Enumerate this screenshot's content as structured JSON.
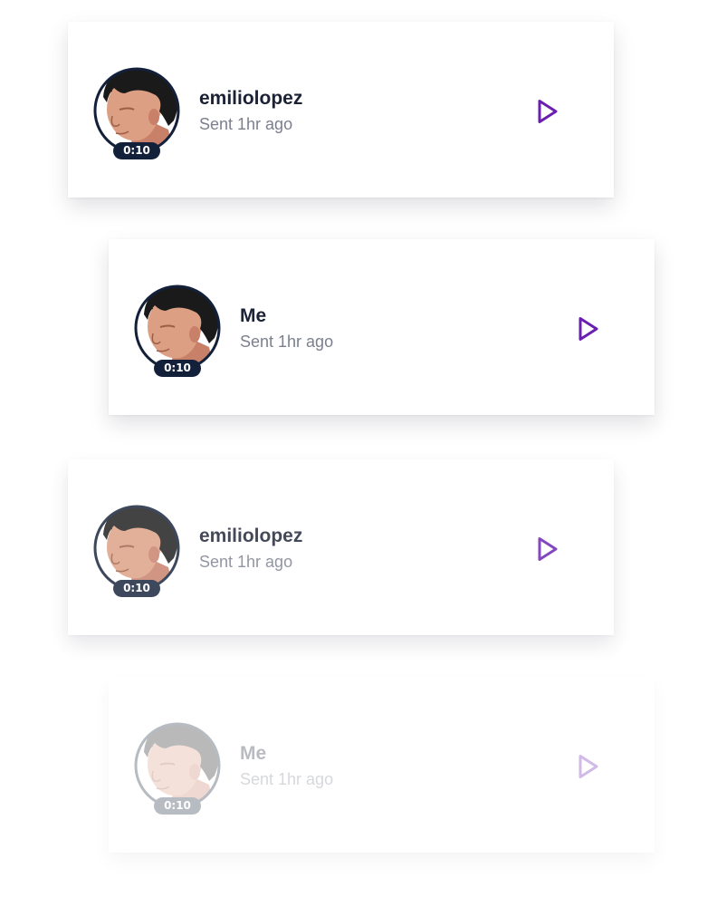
{
  "colors": {
    "accent": "#6b1fb1",
    "text_primary": "#1c2235",
    "text_secondary": "#7b7f8e",
    "badge_bg": "#13203a",
    "badge_text": "#ffffff",
    "card_bg": "#ffffff"
  },
  "messages": [
    {
      "sender": "emiliolopez",
      "sent": "Sent 1hr ago",
      "duration": "0:10",
      "avatar_icon": "user-avatar-portrait",
      "play_icon": "play-icon"
    },
    {
      "sender": "Me",
      "sent": "Sent 1hr ago",
      "duration": "0:10",
      "avatar_icon": "user-avatar-portrait",
      "play_icon": "play-icon"
    },
    {
      "sender": "emiliolopez",
      "sent": "Sent 1hr ago",
      "duration": "0:10",
      "avatar_icon": "user-avatar-portrait",
      "play_icon": "play-icon"
    },
    {
      "sender": "Me",
      "sent": "Sent 1hr ago",
      "duration": "0:10",
      "avatar_icon": "user-avatar-portrait",
      "play_icon": "play-icon"
    }
  ]
}
